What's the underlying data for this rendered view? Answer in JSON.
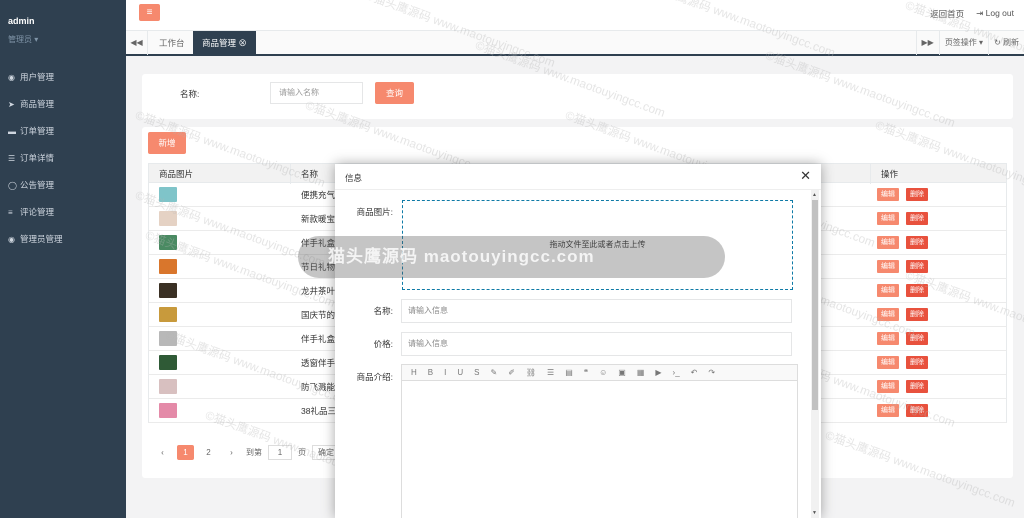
{
  "sidebar": {
    "user": "admin",
    "role": "管理员 ▾",
    "items": [
      {
        "icon": "user-icon",
        "glyph": "◉",
        "label": "用户管理"
      },
      {
        "icon": "send-icon",
        "glyph": "➤",
        "label": "商品管理"
      },
      {
        "icon": "card-icon",
        "glyph": "▬",
        "label": "订单管理"
      },
      {
        "icon": "list-icon",
        "glyph": "☰",
        "label": "订单详情"
      },
      {
        "icon": "chat-icon",
        "glyph": "◯",
        "label": "公告管理"
      },
      {
        "icon": "bars-icon",
        "glyph": "≡",
        "label": "评论管理"
      },
      {
        "icon": "admin-icon",
        "glyph": "◉",
        "label": "管理员管理"
      }
    ]
  },
  "topbar": {
    "menu_glyph": "≡",
    "home": "返回首页",
    "logout": "Log out"
  },
  "tabs": {
    "back": "◀◀",
    "t1": "工作台",
    "t2": "商品管理",
    "forward": "▶▶",
    "ops": "页签操作 ▾",
    "refresh": "↻ 刷新"
  },
  "search": {
    "label": "名称:",
    "placeholder": "请输入名称",
    "button": "查询"
  },
  "table": {
    "add": "新增",
    "headers": [
      "商品图片",
      "名称",
      "操作"
    ],
    "rows": [
      {
        "name": "便携充气",
        "color": "#7fc4c9"
      },
      {
        "name": "新款暖宝",
        "color": "#e5d2c4"
      },
      {
        "name": "伴手礼盒",
        "color": "#4a8a62"
      },
      {
        "name": "节日礼物",
        "color": "#d9762c"
      },
      {
        "name": "龙井茶叶",
        "color": "#3a3024"
      },
      {
        "name": "国庆节的",
        "color": "#c89a3c"
      },
      {
        "name": "伴手礼盒",
        "color": "#b8b8b8"
      },
      {
        "name": "透窗伴手",
        "color": "#2f5a36"
      },
      {
        "name": "防飞溅能",
        "color": "#d8c0c0"
      },
      {
        "name": "38礼品三",
        "color": "#e48aa8"
      }
    ],
    "edit": "编辑",
    "del": "删除",
    "pager": {
      "prev": "‹",
      "p1": "1",
      "p2": "2",
      "next": "›",
      "goto": "到第",
      "page_val": "1",
      "page_unit": "页",
      "confirm": "确定"
    }
  },
  "modal": {
    "title": "信息",
    "close": "✕",
    "image_label": "商品图片:",
    "upload_text": "拖动文件至此或者点击上传",
    "name_label": "名称:",
    "name_placeholder": "请输入信息",
    "price_label": "价格:",
    "price_placeholder": "请输入信息",
    "intro_label": "商品介绍:",
    "toolbar": [
      "H",
      "B",
      "I",
      "U",
      "S",
      "✎",
      "✐",
      "⛓",
      "☰",
      "▤",
      "❝",
      "☺",
      "▣",
      "▦",
      "▶",
      "›_",
      "↶",
      "↷"
    ]
  },
  "overlay_text": "猫头鹰源码 maotouyingcc.com",
  "watermark": "©猫头鹰源码 www.maotouyingcc.com"
}
